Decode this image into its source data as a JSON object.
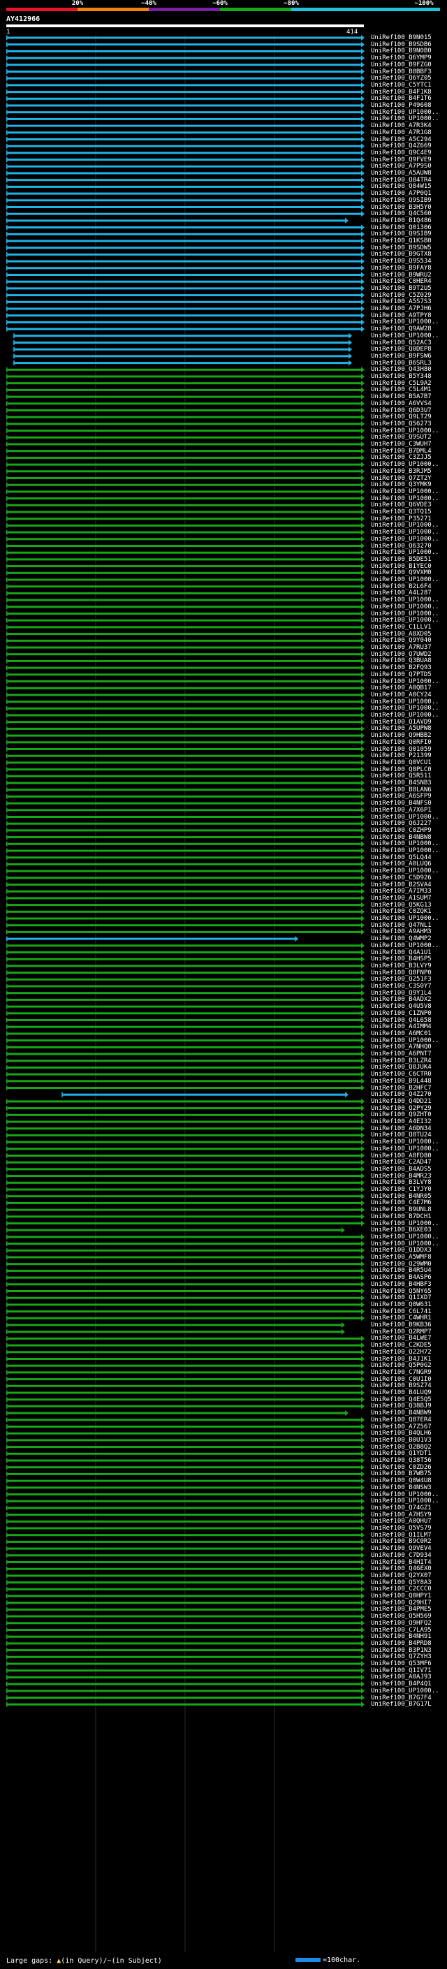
{
  "scale": {
    "labels": [
      "20%",
      "~40%",
      "~60%",
      "~80%",
      "~100%"
    ],
    "colors": [
      "#e8122b",
      "#f2840a",
      "#7b1fa2",
      "#1aa71a",
      "#20c4d8"
    ]
  },
  "query": {
    "id": "AY412966",
    "start": "1",
    "end": "414"
  },
  "hit_colors": {
    "cyan": "#1fb4e6",
    "green": "#17a817"
  },
  "hits": [
    {
      "id": "UniRef100_B9N015",
      "c": "cyan"
    },
    {
      "id": "UniRef100_B9SDB6",
      "c": "cyan"
    },
    {
      "id": "UniRef100_B9N0B0",
      "c": "cyan"
    },
    {
      "id": "UniRef100_Q6YMP9",
      "c": "cyan"
    },
    {
      "id": "UniRef100_B9FZG0",
      "c": "cyan"
    },
    {
      "id": "UniRef100_B8BBF3",
      "c": "cyan"
    },
    {
      "id": "UniRef100_Q6YZ05",
      "c": "cyan"
    },
    {
      "id": "UniRef100_C5YTC1",
      "c": "cyan"
    },
    {
      "id": "UniRef100_B4F1K8",
      "c": "cyan"
    },
    {
      "id": "UniRef100_B4F1T6",
      "c": "cyan"
    },
    {
      "id": "UniRef100_P49608",
      "c": "cyan"
    },
    {
      "id": "UniRef100_UP1000..",
      "c": "cyan"
    },
    {
      "id": "UniRef100_UP1000..",
      "c": "cyan"
    },
    {
      "id": "UniRef100_A7R3K4",
      "c": "cyan"
    },
    {
      "id": "UniRef100_A7R1G8",
      "c": "cyan"
    },
    {
      "id": "UniRef100_A5C294",
      "c": "cyan"
    },
    {
      "id": "UniRef100_Q4Z669",
      "c": "cyan"
    },
    {
      "id": "UniRef100_Q9C4E9",
      "c": "cyan"
    },
    {
      "id": "UniRef100_Q9FVE9",
      "c": "cyan"
    },
    {
      "id": "UniRef100_A7P9S0",
      "c": "cyan"
    },
    {
      "id": "UniRef100_A5AUW8",
      "c": "cyan"
    },
    {
      "id": "UniRef100_Q84TR4",
      "c": "cyan"
    },
    {
      "id": "UniRef100_Q84W15",
      "c": "cyan"
    },
    {
      "id": "UniRef100_A7P0Q1",
      "c": "cyan"
    },
    {
      "id": "UniRef100_Q9SIB9",
      "c": "cyan"
    },
    {
      "id": "UniRef100_B3H5Y0",
      "c": "cyan"
    },
    {
      "id": "UniRef100_Q4C560",
      "c": "cyan"
    },
    {
      "id": "UniRef100_B1Q486",
      "c": "cyan",
      "e": 0.955
    },
    {
      "id": "UniRef100_Q01306",
      "c": "cyan"
    },
    {
      "id": "UniRef100_Q9SIB9",
      "c": "cyan"
    },
    {
      "id": "UniRef100_Q1KSB0",
      "c": "cyan"
    },
    {
      "id": "UniRef100_B9SDW5",
      "c": "cyan"
    },
    {
      "id": "UniRef100_B9GTX8",
      "c": "cyan"
    },
    {
      "id": "UniRef100_Q9S534",
      "c": "cyan"
    },
    {
      "id": "UniRef100_B9FAY8",
      "c": "cyan"
    },
    {
      "id": "UniRef100_B9WRU2",
      "c": "cyan"
    },
    {
      "id": "UniRef100_C0HER4",
      "c": "cyan"
    },
    {
      "id": "UniRef100_B9T2U5",
      "c": "cyan"
    },
    {
      "id": "UniRef100_C5Z029",
      "c": "cyan"
    },
    {
      "id": "UniRef100_A5S7S3",
      "c": "cyan"
    },
    {
      "id": "UniRef100_A7PJH6",
      "c": "cyan"
    },
    {
      "id": "UniRef100_A9TPY8",
      "c": "cyan"
    },
    {
      "id": "UniRef100_UP1000..",
      "c": "cyan"
    },
    {
      "id": "UniRef100_Q9AW28",
      "c": "cyan"
    },
    {
      "id": "UniRef100_UP1000..",
      "c": "cyan",
      "s": 0.02,
      "e": 0.965
    },
    {
      "id": "UniRef100_Q52AC3",
      "c": "cyan",
      "s": 0.02,
      "e": 0.965
    },
    {
      "id": "UniRef100_Q0DEP8",
      "c": "cyan",
      "s": 0.02,
      "e": 0.965
    },
    {
      "id": "UniRef100_B9FSW6",
      "c": "cyan",
      "s": 0.02,
      "e": 0.965
    },
    {
      "id": "UniRef100_B6SRL3",
      "c": "cyan",
      "s": 0.02,
      "e": 0.965
    },
    {
      "id": "UniRef100_Q43H80",
      "c": "green"
    },
    {
      "id": "UniRef100_B5Y348",
      "c": "green"
    },
    {
      "id": "UniRef100_C5L9A2",
      "c": "green"
    },
    {
      "id": "UniRef100_C5L4M1",
      "c": "green"
    },
    {
      "id": "UniRef100_B5A7B7",
      "c": "green"
    },
    {
      "id": "UniRef100_A6VVS4",
      "c": "green"
    },
    {
      "id": "UniRef100_Q6D3U7",
      "c": "green"
    },
    {
      "id": "UniRef100_Q9LT29",
      "c": "green"
    },
    {
      "id": "UniRef100_Q56273",
      "c": "green"
    },
    {
      "id": "UniRef100_UP1000..",
      "c": "green"
    },
    {
      "id": "UniRef100_Q9SUT2",
      "c": "green"
    },
    {
      "id": "UniRef100_C3WUH7",
      "c": "green"
    },
    {
      "id": "UniRef100_B7DML4",
      "c": "green"
    },
    {
      "id": "UniRef100_C3ZJJ5",
      "c": "green"
    },
    {
      "id": "UniRef100_UP1000..",
      "c": "green"
    },
    {
      "id": "UniRef100_B3RJM5",
      "c": "green"
    },
    {
      "id": "UniRef100_Q7ZT2Y",
      "c": "green"
    },
    {
      "id": "UniRef100_Q3YMK9",
      "c": "green"
    },
    {
      "id": "UniRef100_UP1000..",
      "c": "green"
    },
    {
      "id": "UniRef100_UP1000..",
      "c": "green"
    },
    {
      "id": "UniRef100_Q6VDE3",
      "c": "green"
    },
    {
      "id": "UniRef100_Q3TQ15",
      "c": "green"
    },
    {
      "id": "UniRef100_P35271",
      "c": "green"
    },
    {
      "id": "UniRef100_UP1000..",
      "c": "green"
    },
    {
      "id": "UniRef100_UP1000..",
      "c": "green"
    },
    {
      "id": "UniRef100_UP1000..",
      "c": "green"
    },
    {
      "id": "UniRef100_Q63270",
      "c": "green"
    },
    {
      "id": "UniRef100_UP1000..",
      "c": "green"
    },
    {
      "id": "UniRef100_B5DE51",
      "c": "green"
    },
    {
      "id": "UniRef100_B1YEC0",
      "c": "green"
    },
    {
      "id": "UniRef100_Q9VXM0",
      "c": "green"
    },
    {
      "id": "UniRef100_UP1000..",
      "c": "green"
    },
    {
      "id": "UniRef100_B2L6F4",
      "c": "green"
    },
    {
      "id": "UniRef100_A4L287",
      "c": "green"
    },
    {
      "id": "UniRef100_UP1000..",
      "c": "green"
    },
    {
      "id": "UniRef100_UP1000..",
      "c": "green"
    },
    {
      "id": "UniRef100_UP1000..",
      "c": "green"
    },
    {
      "id": "UniRef100_UP1000..",
      "c": "green"
    },
    {
      "id": "UniRef100_C1LLV1",
      "c": "green"
    },
    {
      "id": "UniRef100_A8XD05",
      "c": "green"
    },
    {
      "id": "UniRef100_Q9Y040",
      "c": "green"
    },
    {
      "id": "UniRef100_A7RU37",
      "c": "green"
    },
    {
      "id": "UniRef100_Q7UWD2",
      "c": "green"
    },
    {
      "id": "UniRef100_Q3BUA8",
      "c": "green"
    },
    {
      "id": "UniRef100_B2FQ93",
      "c": "green"
    },
    {
      "id": "UniRef100_Q7PTD5",
      "c": "green"
    },
    {
      "id": "UniRef100_UP1000..",
      "c": "green"
    },
    {
      "id": "UniRef100_A0QB17",
      "c": "green"
    },
    {
      "id": "UniRef100_A0CY24",
      "c": "green"
    },
    {
      "id": "UniRef100_UP1000..",
      "c": "green"
    },
    {
      "id": "UniRef100_UP1000..",
      "c": "green"
    },
    {
      "id": "UniRef100_UP1000..",
      "c": "green"
    },
    {
      "id": "UniRef100_Q1AVD9",
      "c": "green"
    },
    {
      "id": "UniRef100_A5UPW8",
      "c": "green"
    },
    {
      "id": "UniRef100_Q9HBB2",
      "c": "green"
    },
    {
      "id": "UniRef100_Q0RFI0",
      "c": "green"
    },
    {
      "id": "UniRef100_Q01059",
      "c": "green"
    },
    {
      "id": "UniRef100_P21399",
      "c": "green"
    },
    {
      "id": "UniRef100_Q0VCU1",
      "c": "green"
    },
    {
      "id": "UniRef100_Q8PLC0",
      "c": "green"
    },
    {
      "id": "UniRef100_Q5R511",
      "c": "green"
    },
    {
      "id": "UniRef100_B4SNB3",
      "c": "green"
    },
    {
      "id": "UniRef100_B8LAN6",
      "c": "green"
    },
    {
      "id": "UniRef100_A6SFP9",
      "c": "green"
    },
    {
      "id": "UniRef100_B4NFS0",
      "c": "green"
    },
    {
      "id": "UniRef100_A7X6P1",
      "c": "green"
    },
    {
      "id": "UniRef100_UP1000..",
      "c": "green"
    },
    {
      "id": "UniRef100_Q6J227",
      "c": "green"
    },
    {
      "id": "UniRef100_C0ZHP9",
      "c": "green"
    },
    {
      "id": "UniRef100_B4NBW8",
      "c": "green"
    },
    {
      "id": "UniRef100_UP1000..",
      "c": "green"
    },
    {
      "id": "UniRef100_UP1000..",
      "c": "green"
    },
    {
      "id": "UniRef100_Q5LQ44",
      "c": "green"
    },
    {
      "id": "UniRef100_A0LUQ6",
      "c": "green"
    },
    {
      "id": "UniRef100_UP1000..",
      "c": "green"
    },
    {
      "id": "UniRef100_C5D926",
      "c": "green"
    },
    {
      "id": "UniRef100_B2SVA4",
      "c": "green"
    },
    {
      "id": "UniRef100_A7IM33",
      "c": "green"
    },
    {
      "id": "UniRef100_A1SUM7",
      "c": "green"
    },
    {
      "id": "UniRef100_Q5KG13",
      "c": "green"
    },
    {
      "id": "UniRef100_C0ZQK1",
      "c": "green"
    },
    {
      "id": "UniRef100_UP1000..",
      "c": "green"
    },
    {
      "id": "UniRef100_Q47NL1",
      "c": "green"
    },
    {
      "id": "UniRef100_A9AHM3",
      "c": "green"
    },
    {
      "id": "UniRef100_Q4WMP2",
      "c": "cyan",
      "e": 0.815
    },
    {
      "id": "UniRef100_UP1000..",
      "c": "green"
    },
    {
      "id": "UniRef100_Q4A1U1",
      "c": "green"
    },
    {
      "id": "UniRef100_B4HSP5",
      "c": "green"
    },
    {
      "id": "UniRef100_B3LVY9",
      "c": "green"
    },
    {
      "id": "UniRef100_Q8FNP0",
      "c": "green"
    },
    {
      "id": "UniRef100_Q251F3",
      "c": "green"
    },
    {
      "id": "UniRef100_C3S0Y7",
      "c": "green"
    },
    {
      "id": "UniRef100_Q9Y1L4",
      "c": "green"
    },
    {
      "id": "UniRef100_B4ADX2",
      "c": "green"
    },
    {
      "id": "UniRef100_Q4U5V8",
      "c": "green"
    },
    {
      "id": "UniRef100_C1ZNP0",
      "c": "green"
    },
    {
      "id": "UniRef100_Q4L658",
      "c": "green"
    },
    {
      "id": "UniRef100_A4IMM4",
      "c": "green"
    },
    {
      "id": "UniRef100_A6MC01",
      "c": "green"
    },
    {
      "id": "UniRef100_UP1000..",
      "c": "green"
    },
    {
      "id": "UniRef100_A7NHQ0",
      "c": "green"
    },
    {
      "id": "UniRef100_A6PNT7",
      "c": "green"
    },
    {
      "id": "UniRef100_B3LZR4",
      "c": "green"
    },
    {
      "id": "UniRef100_Q8JUK4",
      "c": "green"
    },
    {
      "id": "UniRef100_C6CTR0",
      "c": "green"
    },
    {
      "id": "UniRef100_B9L448",
      "c": "green"
    },
    {
      "id": "UniRef100_B2HFC7",
      "c": "green"
    },
    {
      "id": "UniRef100_Q4Z270",
      "c": "cyan",
      "s": 0.155,
      "e": 0.955
    },
    {
      "id": "UniRef100_Q4DD21",
      "c": "green"
    },
    {
      "id": "UniRef100_Q2PY29",
      "c": "green"
    },
    {
      "id": "UniRef100_Q9ZHT0",
      "c": "green"
    },
    {
      "id": "UniRef100_A4EI32",
      "c": "green"
    },
    {
      "id": "UniRef100_A6DN34",
      "c": "green"
    },
    {
      "id": "UniRef100_Q8TU24",
      "c": "green"
    },
    {
      "id": "UniRef100_UP1000..",
      "c": "green"
    },
    {
      "id": "UniRef100_UP1000..",
      "c": "green"
    },
    {
      "id": "UniRef100_A8FD80",
      "c": "green"
    },
    {
      "id": "UniRef100_C2AD47",
      "c": "green"
    },
    {
      "id": "UniRef100_B4ADS5",
      "c": "green"
    },
    {
      "id": "UniRef100_B4MR23",
      "c": "green"
    },
    {
      "id": "UniRef100_B3LVY8",
      "c": "green"
    },
    {
      "id": "UniRef100_C1YJY0",
      "c": "green"
    },
    {
      "id": "UniRef100_B4NR05",
      "c": "green"
    },
    {
      "id": "UniRef100_C4E7M6",
      "c": "green"
    },
    {
      "id": "UniRef100_B9UNL8",
      "c": "green"
    },
    {
      "id": "UniRef100_B7DCH1",
      "c": "green"
    },
    {
      "id": "UniRef100_UP1000..",
      "c": "green"
    },
    {
      "id": "UniRef100_B6XE03",
      "c": "green",
      "e": 0.945
    },
    {
      "id": "UniRef100_UP1000..",
      "c": "green"
    },
    {
      "id": "UniRef100_UP1000..",
      "c": "green"
    },
    {
      "id": "UniRef100_Q1DDX3",
      "c": "green"
    },
    {
      "id": "UniRef100_A5WMF8",
      "c": "green"
    },
    {
      "id": "UniRef100_Q29WM0",
      "c": "green"
    },
    {
      "id": "UniRef100_B4R5U4",
      "c": "green"
    },
    {
      "id": "UniRef100_B4ASP6",
      "c": "green"
    },
    {
      "id": "UniRef100_B4HBF3",
      "c": "green"
    },
    {
      "id": "UniRef100_Q5NY65",
      "c": "green"
    },
    {
      "id": "UniRef100_Q1IXD7",
      "c": "green"
    },
    {
      "id": "UniRef100_Q0W631",
      "c": "green"
    },
    {
      "id": "UniRef100_C6L741",
      "c": "green"
    },
    {
      "id": "UniRef100_C4WHR1",
      "c": "green"
    },
    {
      "id": "UniRef100_B9KB36",
      "c": "green",
      "e": 0.945
    },
    {
      "id": "UniRef100_Q2RMP7",
      "c": "green",
      "e": 0.945
    },
    {
      "id": "UniRef100_B4LWE7",
      "c": "green"
    },
    {
      "id": "UniRef100_C2KDE5",
      "c": "green"
    },
    {
      "id": "UniRef100_Q22H72",
      "c": "green"
    },
    {
      "id": "UniRef100_B4J1K1",
      "c": "green"
    },
    {
      "id": "UniRef100_Q5P0G2",
      "c": "green"
    },
    {
      "id": "UniRef100_C7NGR9",
      "c": "green"
    },
    {
      "id": "UniRef100_C0U1I0",
      "c": "green"
    },
    {
      "id": "UniRef100_B9SZ74",
      "c": "green"
    },
    {
      "id": "UniRef100_B4LUQ9",
      "c": "green"
    },
    {
      "id": "UniRef100_Q4E5Q5",
      "c": "green"
    },
    {
      "id": "UniRef100_Q38BJ9",
      "c": "green"
    },
    {
      "id": "UniRef100_B4NBW9",
      "c": "green",
      "e": 0.955
    },
    {
      "id": "UniRef100_Q87ER4",
      "c": "green"
    },
    {
      "id": "UniRef100_A7Z567",
      "c": "green"
    },
    {
      "id": "UniRef100_B4QLH6",
      "c": "green"
    },
    {
      "id": "UniRef100_B0U1V3",
      "c": "green"
    },
    {
      "id": "UniRef100_Q2B8Q2",
      "c": "green"
    },
    {
      "id": "UniRef100_Q1YDT1",
      "c": "green"
    },
    {
      "id": "UniRef100_Q38T56",
      "c": "green"
    },
    {
      "id": "UniRef100_C0ZD26",
      "c": "green"
    },
    {
      "id": "UniRef100_B7WB75",
      "c": "green"
    },
    {
      "id": "UniRef100_Q0W4U8",
      "c": "green"
    },
    {
      "id": "UniRef100_B4NSW3",
      "c": "green"
    },
    {
      "id": "UniRef100_UP1000..",
      "c": "green"
    },
    {
      "id": "UniRef100_UP1000..",
      "c": "green"
    },
    {
      "id": "UniRef100_Q74GZ1",
      "c": "green"
    },
    {
      "id": "UniRef100_A7HSY9",
      "c": "green"
    },
    {
      "id": "UniRef100_A0QHU7",
      "c": "green"
    },
    {
      "id": "UniRef100_Q5VS79",
      "c": "green"
    },
    {
      "id": "UniRef100_Q1ILM7",
      "c": "green"
    },
    {
      "id": "UniRef100_B9C0R2",
      "c": "green"
    },
    {
      "id": "UniRef100_Q9VEV4",
      "c": "green"
    },
    {
      "id": "UniRef100_C7D934",
      "c": "green"
    },
    {
      "id": "UniRef100_B4HIT4",
      "c": "green"
    },
    {
      "id": "UniRef100_Q46EX0",
      "c": "green"
    },
    {
      "id": "UniRef100_Q2YX07",
      "c": "green"
    },
    {
      "id": "UniRef100_Q5Y8A3",
      "c": "green"
    },
    {
      "id": "UniRef100_C2CCC0",
      "c": "green"
    },
    {
      "id": "UniRef100_Q0HPY1",
      "c": "green"
    },
    {
      "id": "UniRef100_Q29HI7",
      "c": "green"
    },
    {
      "id": "UniRef100_B4PME5",
      "c": "green"
    },
    {
      "id": "UniRef100_Q5H569",
      "c": "green"
    },
    {
      "id": "UniRef100_Q9HFQ2",
      "c": "green"
    },
    {
      "id": "UniRef100_C7LA95",
      "c": "green"
    },
    {
      "id": "UniRef100_B4NH91",
      "c": "green"
    },
    {
      "id": "UniRef100_B4PRD8",
      "c": "green"
    },
    {
      "id": "UniRef100_B3P1N3",
      "c": "green"
    },
    {
      "id": "UniRef100_Q7ZYH3",
      "c": "green"
    },
    {
      "id": "UniRef100_Q53MF6",
      "c": "green"
    },
    {
      "id": "UniRef100_Q1IV71",
      "c": "green"
    },
    {
      "id": "UniRef100_A0AJ93",
      "c": "green"
    },
    {
      "id": "UniRef100_B4P4Q1",
      "c": "green"
    },
    {
      "id": "UniRef100_UP1000..",
      "c": "green"
    },
    {
      "id": "UniRef100_B7G7F4",
      "c": "green"
    },
    {
      "id": "UniRef100_B7G17L",
      "c": "green"
    }
  ],
  "legend": {
    "prefix": "Large gaps:",
    "sym_query": "▲",
    "text_query": "(in Query)",
    "sep": "/",
    "sym_subject": "~",
    "text_subject": "(in Subject)",
    "scale_text": "=100char."
  }
}
